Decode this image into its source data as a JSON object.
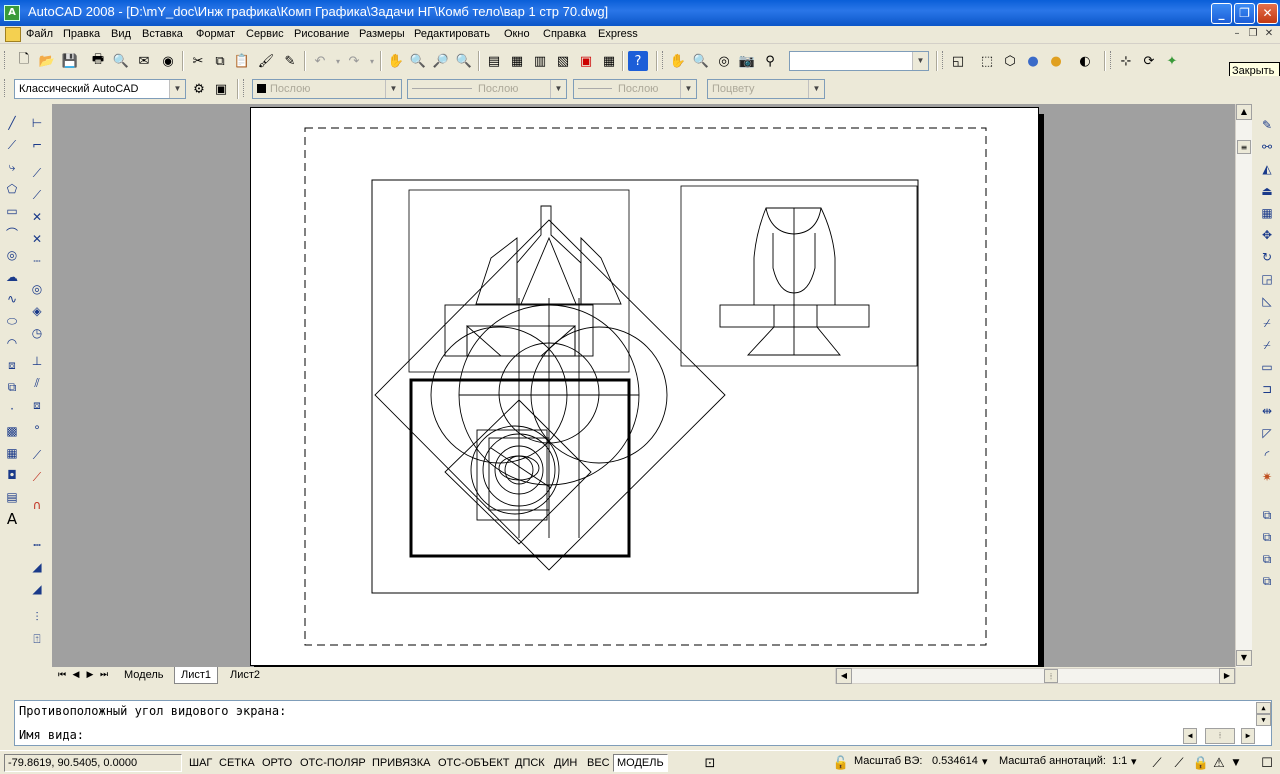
{
  "window": {
    "title": "AutoCAD 2008 - [D:\\mY_doc\\Инж графика\\Комп Графика\\Задачи НГ\\Комб тело\\вар 1 стр 70.dwg]"
  },
  "menu": [
    "Файл",
    "Правка",
    "Вид",
    "Вставка",
    "Формат",
    "Сервис",
    "Рисование",
    "Размеры",
    "Редактировать",
    "Окно",
    "Справка",
    "Express"
  ],
  "tooltip": "Закрыть",
  "toolbar2": {
    "workspace": "Классический AutoCAD",
    "color": "Послою",
    "linetype": "Послою",
    "lineweight": "Послою",
    "plotstyle": "Поцвету"
  },
  "tabs": [
    "Модель",
    "Лист1",
    "Лист2"
  ],
  "active_tab": "Лист1",
  "command_history": [
    "Противоположный угол видового экрана:",
    "Имя вида:"
  ],
  "status": {
    "coordinates": "-79.8619, 90.5405, 0.0000",
    "toggles": [
      "ШАГ",
      "СЕТКА",
      "ОРТО",
      "ОТС-ПОЛЯР",
      "ПРИВЯЗКА",
      "ОТС-ОБЪЕКТ",
      "ДПСК",
      "ДИН",
      "ВЕС",
      "МОДЕЛЬ"
    ],
    "viewport_scale_label": "Масштаб ВЭ:",
    "viewport_scale_value": "0.534614",
    "annotation_scale_label": "Масштаб аннотаций:",
    "annotation_scale_value": "1:1"
  },
  "icons": {
    "draw_tools": [
      "line-icon",
      "construction-line-icon",
      "polyline-icon",
      "polygon-icon",
      "rectangle-icon",
      "arc-icon",
      "circle-icon",
      "revision-cloud-icon",
      "spline-icon",
      "ellipse-icon",
      "ellipse-arc-icon",
      "insert-block-icon",
      "make-block-icon",
      "point-icon",
      "hatch-icon",
      "gradient-icon",
      "region-icon",
      "table-icon",
      "multiline-text-icon"
    ],
    "dimension_tools": [
      "linear-dimension-icon",
      "aligned-dimension-icon",
      "arc-length-icon",
      "ordinate-icon",
      "radius-icon",
      "jogged-icon",
      "diameter-icon",
      "angular-icon",
      "quick-dimension-icon",
      "baseline-icon",
      "continue-icon",
      "quick-leader-icon",
      "tolerance-icon",
      "center-mark-icon",
      "dimension-edit-icon",
      "dimension-text-edit-icon",
      "dimension-update-icon",
      "dimension-style-icon"
    ],
    "modify_tools": [
      "erase-icon",
      "copy-icon",
      "mirror-icon",
      "offset-icon",
      "array-icon",
      "move-icon",
      "rotate-icon",
      "scale-icon",
      "stretch-icon",
      "trim-icon",
      "extend-icon",
      "break-at-point-icon",
      "break-icon",
      "join-icon",
      "chamfer-icon",
      "fillet-icon",
      "explode-icon",
      "draworder-front-icon",
      "draworder-back-icon",
      "draworder-above-icon",
      "draworder-under-icon"
    ]
  }
}
